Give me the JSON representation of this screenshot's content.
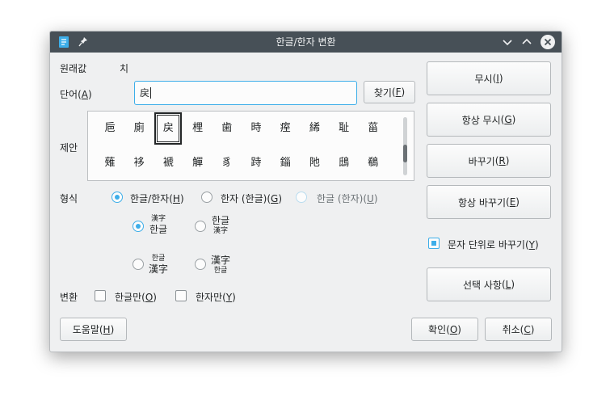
{
  "window": {
    "title": "한글/한자 변환"
  },
  "original": {
    "label": "원래값",
    "value": "치"
  },
  "word": {
    "label": "단어(A)",
    "label_text": "단어",
    "mnemonic": "A",
    "value": "戻"
  },
  "find_button": {
    "text": "찾기",
    "mnemonic": "F"
  },
  "suggestions": {
    "label": "제안",
    "row1": [
      "巵",
      "廁",
      "戻",
      "梩",
      "歯",
      "時",
      "痓",
      "絺",
      "耻",
      "菑"
    ],
    "row2": [
      "薙",
      "袳",
      "褫",
      "觶",
      "豸",
      "跱",
      "錙",
      "阤",
      "鴟",
      "鵗"
    ],
    "selected_index": 2
  },
  "format": {
    "label": "형식",
    "opt1": {
      "text": "한글/한자",
      "mnemonic": "H"
    },
    "opt2": {
      "text": "한자 (한글)",
      "mnemonic": "G"
    },
    "opt3": {
      "text": "한글 (한자)",
      "mnemonic": "U"
    },
    "ruby1": {
      "small": "漢字",
      "big": "한글"
    },
    "ruby2": {
      "big": "한글",
      "small": "漢字"
    },
    "ruby3": {
      "small": "한글",
      "big": "漢字"
    },
    "ruby4": {
      "big": "漢字",
      "small": "한글"
    }
  },
  "conversion": {
    "label": "변환",
    "hangul_only": {
      "text": "한글만",
      "mnemonic": "O"
    },
    "hanja_only": {
      "text": "한자만",
      "mnemonic": "Y"
    }
  },
  "right_buttons": {
    "ignore": {
      "text": "무시",
      "mnemonic": "I"
    },
    "ignore_all": {
      "text": "항상 무시",
      "mnemonic": "G"
    },
    "replace": {
      "text": "바꾸기",
      "mnemonic": "R"
    },
    "replace_all": {
      "text": "항상 바꾸기",
      "mnemonic": "E"
    },
    "char_by_char": {
      "text": "문자 단위로 바꾸기",
      "mnemonic": "Y"
    },
    "options": {
      "text": "선택 사항",
      "mnemonic": "L"
    }
  },
  "bottom": {
    "help": {
      "text": "도움말",
      "mnemonic": "H"
    },
    "ok": {
      "text": "확인",
      "mnemonic": "O"
    },
    "cancel": {
      "text": "취소",
      "mnemonic": "C"
    }
  },
  "colors": {
    "titlebar": "#475057",
    "accent": "#3daee9",
    "background": "#eff0f1"
  }
}
